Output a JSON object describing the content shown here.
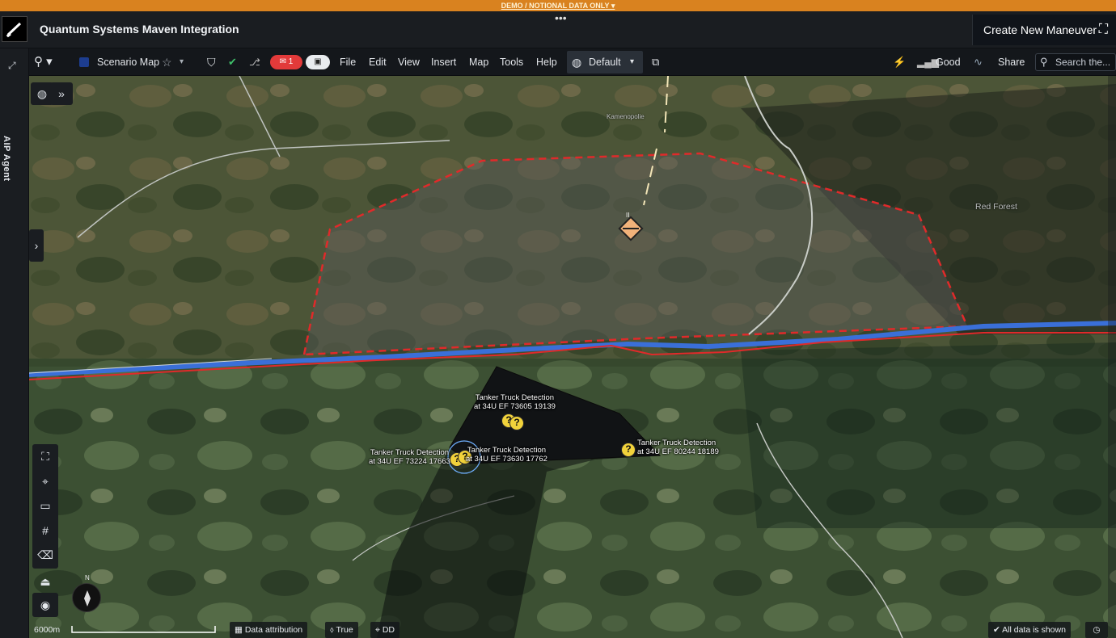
{
  "banner": {
    "text": "DEMO / NOTIONAL DATA ONLY ▾"
  },
  "app": {
    "title": "Quantum Systems Maven Integration",
    "create_button": "Create New Maneuver"
  },
  "left_rail": {
    "agent_label": "AIP Agent"
  },
  "toolbar": {
    "doc_name": "Scenario Map",
    "alert_count": "1",
    "menus": [
      "File",
      "Edit",
      "View",
      "Insert",
      "Map",
      "Tools",
      "Help"
    ],
    "layout_default": "Default",
    "signal_status": "Good",
    "share_label": "Share",
    "search_placeholder": "Search the..."
  },
  "map": {
    "places": [
      "Kamenopolie",
      "Red Forest"
    ],
    "detections": [
      {
        "title": "Tanker Truck Detection",
        "coords": "at 34U EF 73605 19139"
      },
      {
        "title": "Tanker Truck Detection",
        "coords": "at 34U EF 73224 17663"
      },
      {
        "title": "Tanker Truck Detection",
        "coords": "at 34U EF 73630 17762"
      },
      {
        "title": "Tanker Truck Detection",
        "coords": "at 34U EF 80244 18189"
      }
    ],
    "unit_marker_label": "II"
  },
  "statusbar": {
    "scale": "6000m",
    "attribution": "Data attribution",
    "north": "True",
    "coord_format": "DD",
    "data_status": "All data is shown"
  },
  "colors": {
    "banner": "#d9821f",
    "boundary_red": "#e02a2a",
    "river_blue": "#3a6fd8",
    "detection_yellow": "#f1d23b"
  }
}
